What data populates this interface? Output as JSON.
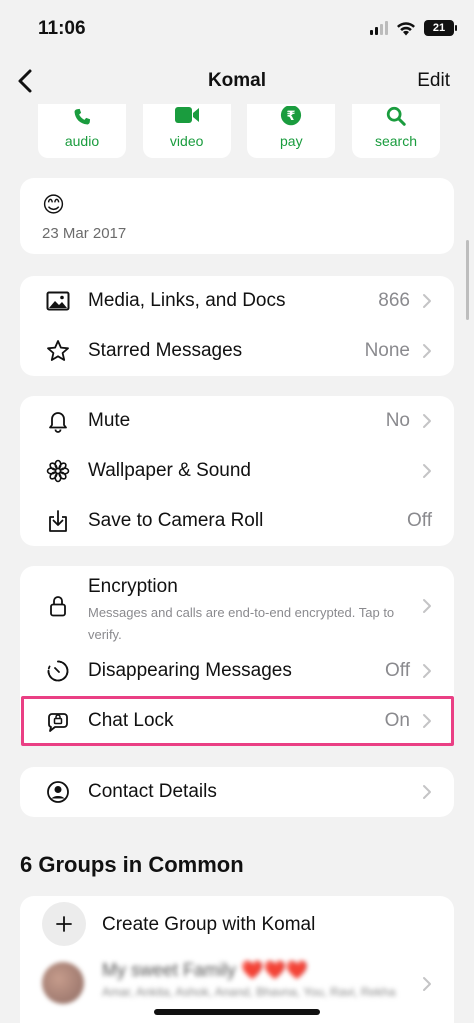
{
  "status_bar": {
    "time": "11:06",
    "battery": "21"
  },
  "nav": {
    "title": "Komal",
    "edit_label": "Edit"
  },
  "actions": [
    {
      "label": "audio",
      "icon": "phone-icon"
    },
    {
      "label": "video",
      "icon": "video-icon"
    },
    {
      "label": "pay",
      "icon": "rupee-icon"
    },
    {
      "label": "search",
      "icon": "search-icon"
    }
  ],
  "about": {
    "emoji": "😊",
    "date": "23 Mar 2017"
  },
  "media_section": [
    {
      "label": "Media, Links, and Docs",
      "value": "866",
      "icon": "image-icon"
    },
    {
      "label": "Starred Messages",
      "value": "None",
      "icon": "star-icon"
    }
  ],
  "settings_section": [
    {
      "label": "Mute",
      "value": "No",
      "icon": "bell-icon"
    },
    {
      "label": "Wallpaper & Sound",
      "value": "",
      "icon": "flower-icon"
    },
    {
      "label": "Save to Camera Roll",
      "value": "Off",
      "icon": "download-icon"
    }
  ],
  "privacy_section": {
    "encryption": {
      "title": "Encryption",
      "subtitle": "Messages and calls are end-to-end encrypted. Tap to verify."
    },
    "disappearing": {
      "label": "Disappearing Messages",
      "value": "Off"
    },
    "chat_lock": {
      "label": "Chat Lock",
      "value": "On"
    }
  },
  "contact_details": {
    "label": "Contact Details"
  },
  "groups": {
    "title": "6 Groups in Common",
    "create_label": "Create Group with Komal",
    "first_group": {
      "name": "My sweet Family",
      "hearts": "❤️❤️❤️",
      "members": "Amar, Ankita, Ashok, Anand, Bhavna, You, Ravi, Rekha"
    }
  },
  "colors": {
    "accent": "#1a9c3e",
    "highlight": "#ea3f84",
    "background": "#f2f2f2"
  }
}
